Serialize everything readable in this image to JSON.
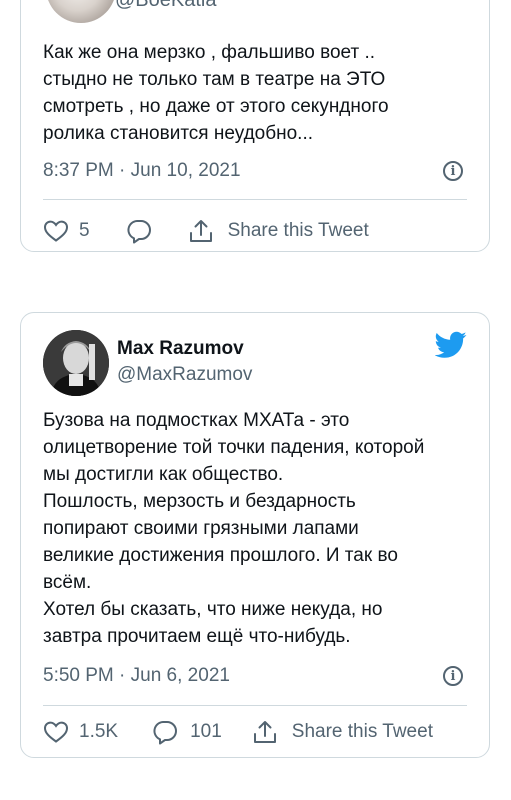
{
  "tweet1": {
    "handle": "@BoeKatia",
    "text_lines": [
      "Как же она мерзко , фальшиво воет ..",
      "стыдно не только там в театре на ЭТО",
      "смотреть , но даже от этого секундного",
      "ролика становится неудобно..."
    ],
    "timestamp": "8:37 PM · Jun 10, 2021",
    "likes": "5",
    "share_label": "Share this Tweet"
  },
  "tweet2": {
    "author_name": "Max Razumov",
    "handle": "@MaxRazumov",
    "text_lines": [
      "Бузова на подмостках МХАТа - это",
      "олицетворение той точки падения, которой",
      "мы достигли как общество.",
      "Пошлость, мерзость и бездарность",
      "попирают своими грязными лапами",
      "великие достижения прошлого. И так во",
      "всём.",
      "Хотел бы сказать, что ниже некуда, но",
      "завтра прочитаем ещё что-нибудь."
    ],
    "timestamp": "5:50 PM · Jun 6, 2021",
    "likes": "1.5K",
    "replies": "101",
    "share_label": "Share this Tweet"
  },
  "icons": {
    "like": "heart-icon",
    "reply": "speech-bubble-icon",
    "share": "share-upload-icon",
    "info": "info-icon",
    "brand": "twitter-bird-icon"
  },
  "colors": {
    "brand": "#1d9bf0",
    "secondary_text": "#536471",
    "border": "#cfd9de"
  }
}
